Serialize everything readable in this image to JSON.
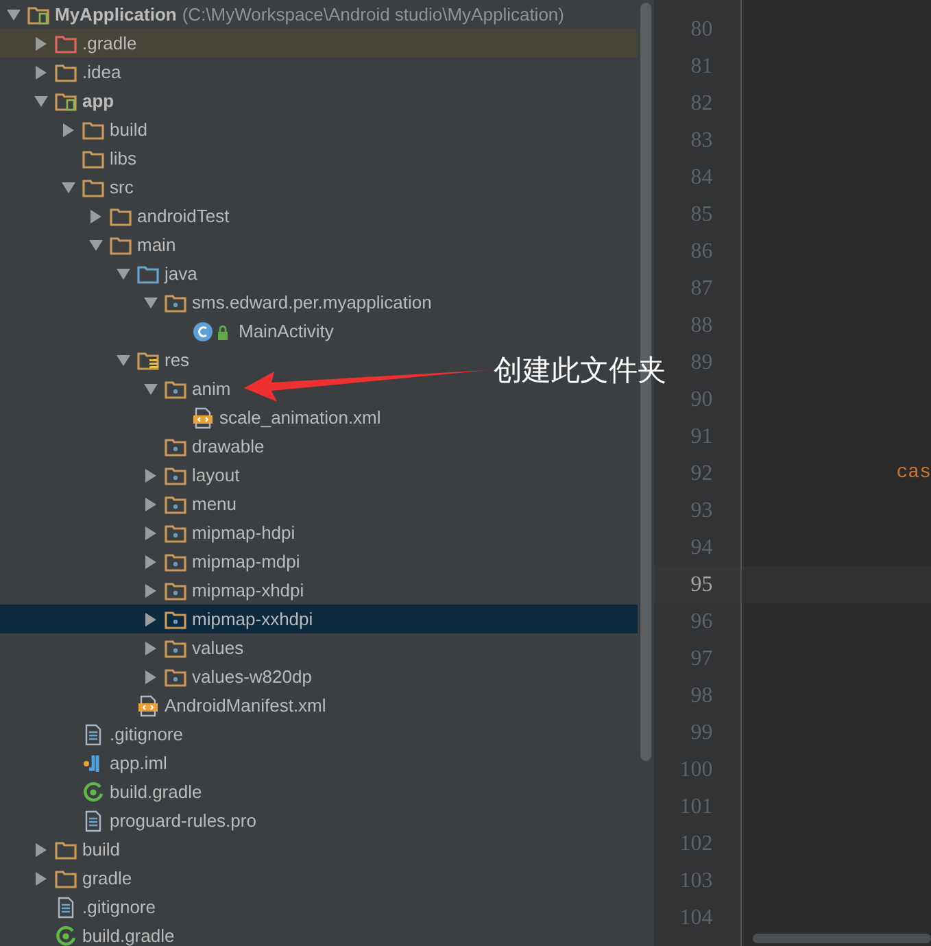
{
  "project_tree": {
    "root": {
      "label": "MyApplication",
      "path": "(C:\\MyWorkspace\\Android studio\\MyApplication)",
      "kind": "project",
      "expanded": true,
      "selected": false,
      "children": [
        {
          "label": ".gradle",
          "kind": "excluded_folder",
          "expanded": false,
          "selected": false
        },
        {
          "label": ".idea",
          "kind": "folder",
          "expanded": false,
          "selected": false
        },
        {
          "label": "app",
          "kind": "module",
          "expanded": true,
          "selected": false,
          "children": [
            {
              "label": "build",
              "kind": "folder",
              "expanded": false,
              "selected": false
            },
            {
              "label": "libs",
              "kind": "folder",
              "selected": false
            },
            {
              "label": "src",
              "kind": "folder",
              "expanded": true,
              "selected": false,
              "children": [
                {
                  "label": "androidTest",
                  "kind": "folder",
                  "expanded": false,
                  "selected": false
                },
                {
                  "label": "main",
                  "kind": "folder",
                  "expanded": true,
                  "selected": false,
                  "children": [
                    {
                      "label": "java",
                      "kind": "source_folder",
                      "expanded": true,
                      "selected": false,
                      "children": [
                        {
                          "label": "sms.edward.per.myapplication",
                          "kind": "package",
                          "expanded": true,
                          "selected": false,
                          "children": [
                            {
                              "label": "MainActivity",
                              "kind": "class",
                              "selected": false
                            }
                          ]
                        }
                      ]
                    },
                    {
                      "label": "res",
                      "kind": "res_folder",
                      "expanded": true,
                      "selected": false,
                      "children": [
                        {
                          "label": "anim",
                          "kind": "package",
                          "expanded": true,
                          "selected": false,
                          "children": [
                            {
                              "label": "scale_animation.xml",
                              "kind": "xml",
                              "selected": false
                            }
                          ]
                        },
                        {
                          "label": "drawable",
                          "kind": "package",
                          "selected": false
                        },
                        {
                          "label": "layout",
                          "kind": "package",
                          "expanded": false,
                          "selected": false
                        },
                        {
                          "label": "menu",
                          "kind": "package",
                          "expanded": false,
                          "selected": false
                        },
                        {
                          "label": "mipmap-hdpi",
                          "kind": "package",
                          "expanded": false,
                          "selected": false
                        },
                        {
                          "label": "mipmap-mdpi",
                          "kind": "package",
                          "expanded": false,
                          "selected": false
                        },
                        {
                          "label": "mipmap-xhdpi",
                          "kind": "package",
                          "expanded": false,
                          "selected": false
                        },
                        {
                          "label": "mipmap-xxhdpi",
                          "kind": "package",
                          "expanded": false,
                          "selected": true
                        },
                        {
                          "label": "values",
                          "kind": "package",
                          "expanded": false,
                          "selected": false
                        },
                        {
                          "label": "values-w820dp",
                          "kind": "package",
                          "expanded": false,
                          "selected": false
                        }
                      ]
                    },
                    {
                      "label": "AndroidManifest.xml",
                      "kind": "xml",
                      "selected": false
                    }
                  ]
                }
              ]
            },
            {
              "label": ".gitignore",
              "kind": "text",
              "selected": false
            },
            {
              "label": "app.iml",
              "kind": "iml",
              "selected": false
            },
            {
              "label": "build.gradle",
              "kind": "gradle",
              "selected": false
            },
            {
              "label": "proguard-rules.pro",
              "kind": "text",
              "selected": false
            }
          ]
        },
        {
          "label": "build",
          "kind": "folder",
          "expanded": false,
          "selected": false
        },
        {
          "label": "gradle",
          "kind": "folder",
          "expanded": false,
          "selected": false
        },
        {
          "label": ".gitignore",
          "kind": "text",
          "selected": false
        },
        {
          "label": "build.gradle",
          "kind": "gradle",
          "selected": false
        }
      ]
    }
  },
  "editor": {
    "lines": [
      {
        "number": "80",
        "current": false
      },
      {
        "number": "81",
        "current": false
      },
      {
        "number": "82",
        "current": false
      },
      {
        "number": "83",
        "current": false
      },
      {
        "number": "84",
        "current": false
      },
      {
        "number": "85",
        "current": false
      },
      {
        "number": "86",
        "current": false
      },
      {
        "number": "87",
        "current": false
      },
      {
        "number": "88",
        "current": false
      },
      {
        "number": "89",
        "current": false
      },
      {
        "number": "90",
        "current": false
      },
      {
        "number": "91",
        "current": false
      },
      {
        "number": "92",
        "current": false,
        "code": "cas"
      },
      {
        "number": "93",
        "current": false
      },
      {
        "number": "94",
        "current": false
      },
      {
        "number": "95",
        "current": true
      },
      {
        "number": "96",
        "current": false
      },
      {
        "number": "97",
        "current": false
      },
      {
        "number": "98",
        "current": false
      },
      {
        "number": "99",
        "current": false
      },
      {
        "number": "100",
        "current": false
      },
      {
        "number": "101",
        "current": false
      },
      {
        "number": "102",
        "current": false
      },
      {
        "number": "103",
        "current": false
      },
      {
        "number": "104",
        "current": false
      }
    ]
  },
  "annotation": {
    "text": "创建此文件夹"
  }
}
